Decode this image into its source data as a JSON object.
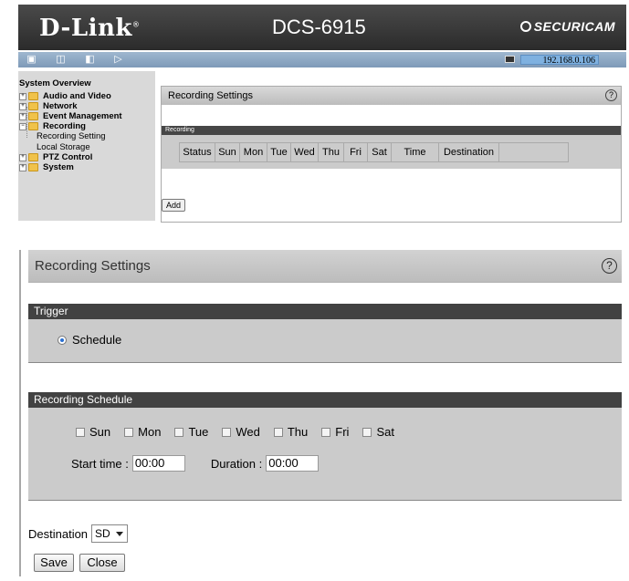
{
  "top": {
    "logo": "D-Link",
    "logo_mark": "®",
    "model": "DCS-6915",
    "brand": "SECURICAM",
    "ip": "192.168.0.106",
    "toolbar_icons": [
      "camera-icon",
      "search-icon",
      "bookmark-icon",
      "exit-icon"
    ],
    "sidebar": {
      "title": "System Overview",
      "items": [
        {
          "label": "Audio and Video",
          "expanded": false
        },
        {
          "label": "Network",
          "expanded": false
        },
        {
          "label": "Event Management",
          "expanded": false
        },
        {
          "label": "Recording",
          "expanded": true
        },
        {
          "label": "Recording Setting",
          "sub": true
        },
        {
          "label": "Local Storage",
          "sub": true
        },
        {
          "label": "PTZ Control",
          "expanded": false
        },
        {
          "label": "System",
          "expanded": false
        }
      ]
    },
    "panel": {
      "title": "Recording Settings",
      "help": "?",
      "section": "Recording",
      "columns": [
        "Status",
        "Sun",
        "Mon",
        "Tue",
        "Wed",
        "Thu",
        "Fri",
        "Sat",
        "Time",
        "Destination",
        ""
      ],
      "add_label": "Add"
    }
  },
  "bottom": {
    "title": "Recording Settings",
    "help": "?",
    "trigger": {
      "header": "Trigger",
      "option": "Schedule",
      "selected": true
    },
    "schedule": {
      "header": "Recording Schedule",
      "days": [
        "Sun",
        "Mon",
        "Tue",
        "Wed",
        "Thu",
        "Fri",
        "Sat"
      ],
      "start_label": "Start time :",
      "start_value": "00:00",
      "duration_label": "Duration :",
      "duration_value": "00:00"
    },
    "destination": {
      "label": "Destination",
      "value": "SD"
    },
    "buttons": {
      "save": "Save",
      "close": "Close"
    }
  }
}
